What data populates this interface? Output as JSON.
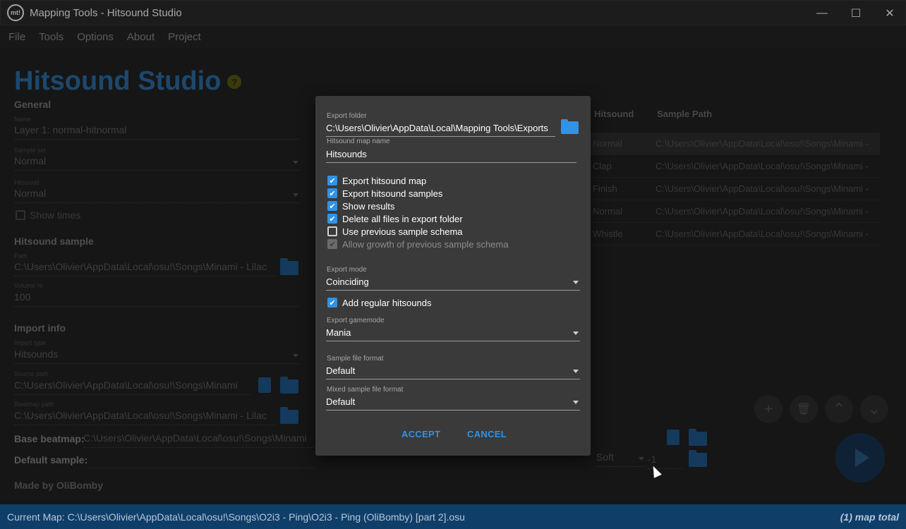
{
  "window": {
    "title": "Mapping Tools - Hitsound Studio",
    "logo_text": "mt!",
    "minimize": "—",
    "maximize": "☐",
    "close": "✕"
  },
  "menu": [
    "File",
    "Tools",
    "Options",
    "About",
    "Project"
  ],
  "background": {
    "heading": "Hitsound Studio",
    "help_icon": "?",
    "general": {
      "title": "General",
      "name_label": "Name",
      "name_value": "Layer 1: normal-hitnormal",
      "sampleset_label": "Sample set",
      "sampleset_value": "Normal",
      "hitsound_label": "Hitsound",
      "hitsound_value": "Normal",
      "show_times": "Show times"
    },
    "hitsound_sample": {
      "title": "Hitsound sample",
      "path_label": "Path",
      "path_value": "C:\\Users\\Olivier\\AppData\\Local\\osu!\\Songs\\Minami - Lilac",
      "volume_label": "Volume %",
      "volume_value": "100"
    },
    "import_info": {
      "title": "Import info",
      "type_label": "Import type",
      "type_value": "Hitsounds",
      "source_label": "Source path",
      "source_value": "C:\\Users\\Olivier\\AppData\\Local\\osu!\\Songs\\Minami",
      "beatmap_label": "Beatmap path",
      "beatmap_value": "C:\\Users\\Olivier\\AppData\\Local\\osu!\\Songs\\Minami - Lilac"
    },
    "base_beatmap_label": "Base beatmap:",
    "base_beatmap_value": "C:\\Users\\Olivier\\AppData\\Local\\osu!\\Songs\\Minami",
    "default_sample_label": "Default sample:",
    "default_sample_set": "Soft",
    "default_sample_index": "-1",
    "made_by": "Made by OliBomby",
    "table": {
      "headers": [
        "Hitsound",
        "Sample Path"
      ],
      "rows": [
        {
          "hitsound": "Normal",
          "path": "C:\\Users\\Olivier\\AppData\\Local\\osu!\\Songs\\Minami -"
        },
        {
          "hitsound": "Clap",
          "path": "C:\\Users\\Olivier\\AppData\\Local\\osu!\\Songs\\Minami -"
        },
        {
          "hitsound": "Finish",
          "path": "C:\\Users\\Olivier\\AppData\\Local\\osu!\\Songs\\Minami -"
        },
        {
          "hitsound": "Normal",
          "path": "C:\\Users\\Olivier\\AppData\\Local\\osu!\\Songs\\Minami -"
        },
        {
          "hitsound": "Whistle",
          "path": "C:\\Users\\Olivier\\AppData\\Local\\osu!\\Songs\\Minami -"
        }
      ]
    },
    "action_icons": {
      "add": "+",
      "delete": "🗑",
      "up": "⌃",
      "down": "⌄"
    }
  },
  "dialog": {
    "export_folder_label": "Export folder",
    "export_folder_value": "C:\\Users\\Olivier\\AppData\\Local\\Mapping Tools\\Exports",
    "map_name_label": "Hitsound map name",
    "map_name_value": "Hitsounds",
    "options": [
      {
        "label": "Export hitsound map",
        "state": "on"
      },
      {
        "label": "Export hitsound samples",
        "state": "on"
      },
      {
        "label": "Show results",
        "state": "on"
      },
      {
        "label": "Delete all files in export folder",
        "state": "on"
      },
      {
        "label": "Use previous sample schema",
        "state": "off"
      },
      {
        "label": "Allow growth of previous sample schema",
        "state": "disabled"
      }
    ],
    "export_mode_label": "Export mode",
    "export_mode_value": "Coinciding",
    "add_regular_label": "Add regular hitsounds",
    "gamemode_label": "Export gamemode",
    "gamemode_value": "Mania",
    "sample_format_label": "Sample file format",
    "sample_format_value": "Default",
    "mixed_format_label": "Mixed sample file format",
    "mixed_format_value": "Default",
    "accept": "ACCEPT",
    "cancel": "CANCEL"
  },
  "status": {
    "current_map": "Current Map: C:\\Users\\Olivier\\AppData\\Local\\osu!\\Songs\\O2i3 - Ping\\O2i3 - Ping (OliBomby) [part 2].osu",
    "map_total": "(1) map total"
  },
  "colors": {
    "accent": "#2f93e8",
    "statusbar": "#0f3e69",
    "dialog": "#3a3a3a"
  }
}
